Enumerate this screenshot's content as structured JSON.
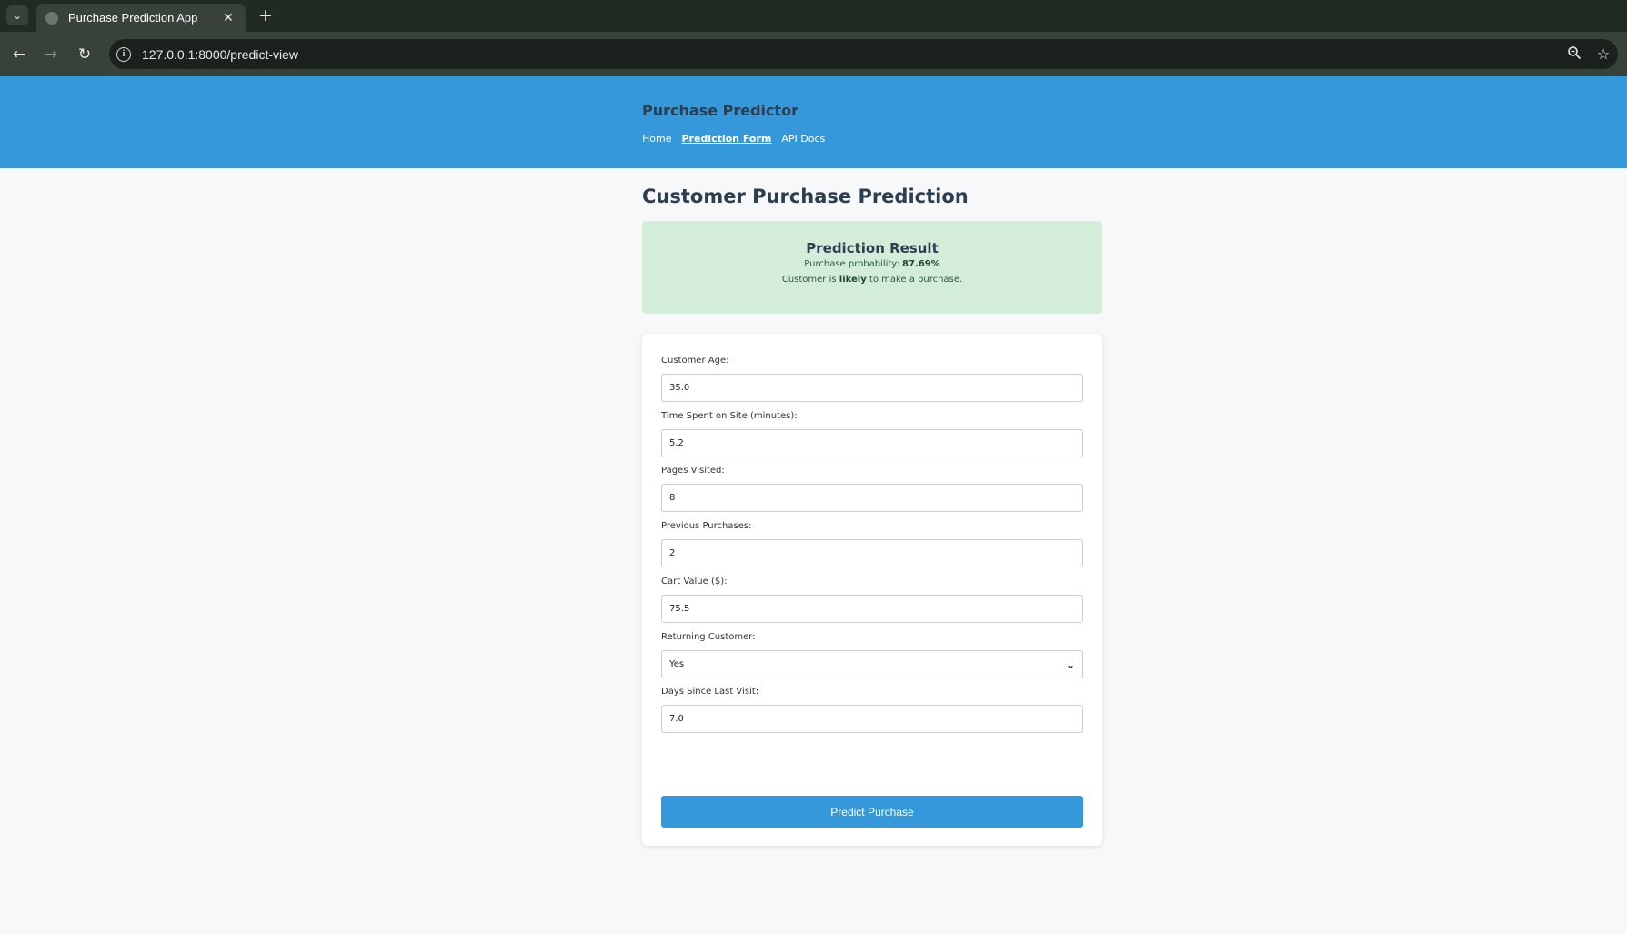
{
  "browser": {
    "tab_title": "Purchase Prediction App",
    "tab_close": "✕",
    "new_tab": "+",
    "url": "127.0.0.1:8000/predict-view",
    "info_glyph": "i"
  },
  "header": {
    "brand": "Purchase Predictor",
    "nav": [
      {
        "label": "Home",
        "active": false
      },
      {
        "label": "Prediction Form",
        "active": true
      },
      {
        "label": "API Docs",
        "active": false
      }
    ]
  },
  "main": {
    "title": "Customer Purchase Prediction",
    "result": {
      "title": "Prediction Result",
      "probability_prefix": "Purchase probability: ",
      "probability_value": "87.69%",
      "verdict_prefix": "Customer is ",
      "verdict_value": "likely",
      "verdict_suffix": " to make a purchase."
    },
    "form": {
      "fields": [
        {
          "label": "Customer Age:",
          "value": "35.0"
        },
        {
          "label": "Time Spent on Site (minutes):",
          "value": "5.2"
        },
        {
          "label": "Pages Visited:",
          "value": "8"
        },
        {
          "label": "Previous Purchases:",
          "value": "2"
        },
        {
          "label": "Cart Value ($):",
          "value": "75.5"
        },
        {
          "label": "Returning Customer:",
          "value": "Yes"
        },
        {
          "label": "Days Since Last Visit:",
          "value": "7.0"
        }
      ],
      "submit_label": "Predict Purchase"
    }
  },
  "colors": {
    "header_bg": "#3498db",
    "result_bg": "#d4edda",
    "button_bg": "#3498db",
    "title_text": "#2c3e50"
  }
}
